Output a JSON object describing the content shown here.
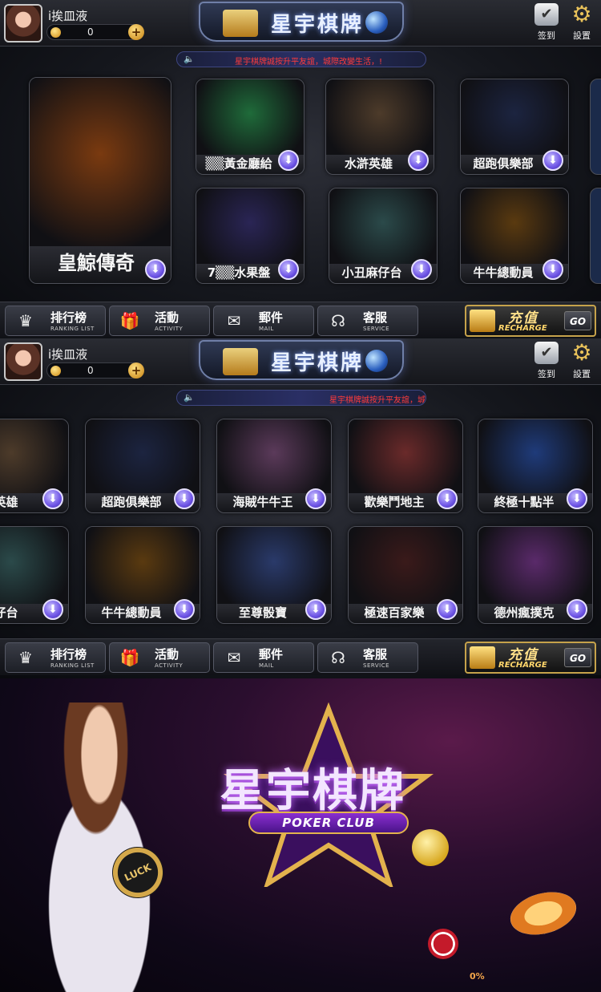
{
  "user": {
    "name": "i挨皿液",
    "coins": "0",
    "add_label": "+"
  },
  "header": {
    "logo_text": "星宇棋牌",
    "signin_label": "签到",
    "settings_label": "設置"
  },
  "marquee": {
    "text": "星宇棋牌誠按升平友誼，城際改變生活，!"
  },
  "screen1_games": [
    {
      "name": "皇鯨傳奇",
      "color": "#7a3a10"
    },
    {
      "name": "▒▒黃金廳給",
      "color": "#1f6b3a"
    },
    {
      "name": "水滸英雄",
      "color": "#4d3b2a"
    },
    {
      "name": "超跑俱樂部",
      "color": "#1c2440"
    },
    {
      "name": "7▒▒水果盤",
      "color": "#2a2555"
    },
    {
      "name": "小丑麻仔台",
      "color": "#2b4a4a"
    },
    {
      "name": "牛牛總動員",
      "color": "#5a3a10"
    }
  ],
  "screen2_games_row1": [
    {
      "name": "滸英雄",
      "color": "#4d3b2a"
    },
    {
      "name": "超跑俱樂部",
      "color": "#1c2440"
    },
    {
      "name": "海賊牛牛王",
      "color": "#5b3a5a"
    },
    {
      "name": "歡樂鬥地主",
      "color": "#6a2a2a"
    },
    {
      "name": "終極十點半",
      "color": "#1f3b7a"
    }
  ],
  "screen2_games_row2": [
    {
      "name": "麻仔台",
      "color": "#2b4a4a"
    },
    {
      "name": "牛牛總動員",
      "color": "#5a3a10"
    },
    {
      "name": "至尊骰寶",
      "color": "#2a3a6a"
    },
    {
      "name": "極速百家樂",
      "color": "#3a1a1a"
    },
    {
      "name": "德州瘋撲克",
      "color": "#5a2a6a"
    }
  ],
  "bottom_nav": [
    {
      "title": "排行榜",
      "sub": "RANKING LIST",
      "icon": "crown-icon",
      "glyph": "♛"
    },
    {
      "title": "活動",
      "sub": "ACTIVITY",
      "icon": "gift-icon",
      "glyph": "🎁"
    },
    {
      "title": "郵件",
      "sub": "MAIL",
      "icon": "mail-icon",
      "glyph": "✉"
    },
    {
      "title": "客服",
      "sub": "SERVICE",
      "icon": "headset-icon",
      "glyph": "☊"
    }
  ],
  "recharge": {
    "title": "充值",
    "sub": "RECHARGE",
    "go": "GO"
  },
  "splash": {
    "title": "星宇棋牌",
    "subtitle": "POKER CLUB",
    "chip_label": "LUCK",
    "progress": "0%"
  },
  "colors": {
    "accent_gold": "#e3b24d",
    "download_purple": "#6f55e6",
    "marquee_red": "#ff3b3b"
  }
}
